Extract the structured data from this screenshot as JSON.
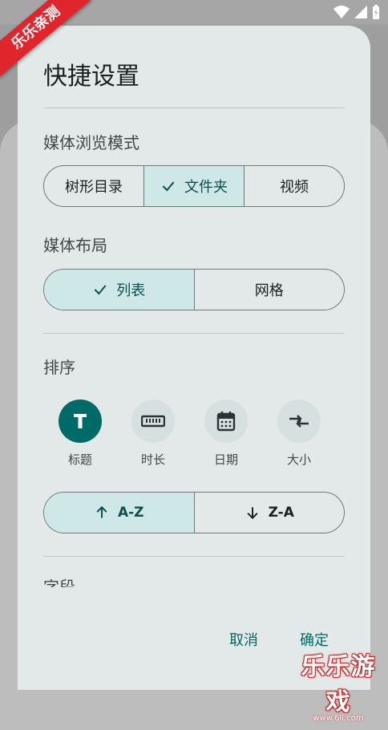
{
  "watermark": {
    "ribbon_text": "乐乐亲测",
    "logo_text": "乐乐游戏",
    "logo_sub": "www.6ll.com"
  },
  "dialog": {
    "title": "快捷设置",
    "browse_mode": {
      "label": "媒体浏览模式",
      "options": [
        "树形目录",
        "文件夹",
        "视频"
      ],
      "selected": "文件夹"
    },
    "layout": {
      "label": "媒体布局",
      "options": [
        "列表",
        "网格"
      ],
      "selected": "列表"
    },
    "sort": {
      "label": "排序",
      "options": [
        {
          "label": "标题",
          "icon": "title-t-icon"
        },
        {
          "label": "时长",
          "icon": "ruler-icon"
        },
        {
          "label": "日期",
          "icon": "calendar-icon"
        },
        {
          "label": "大小",
          "icon": "swap-arrows-icon"
        }
      ],
      "selected": "标题",
      "order_options": [
        "A-Z",
        "Z-A"
      ],
      "order_selected": "A-Z"
    },
    "fields_label": "字段",
    "cancel_label": "取消",
    "confirm_label": "确定"
  },
  "colors": {
    "accent": "#006a68",
    "selected_bg": "#cde8e7",
    "dialog_bg": "#e3e9e9"
  }
}
